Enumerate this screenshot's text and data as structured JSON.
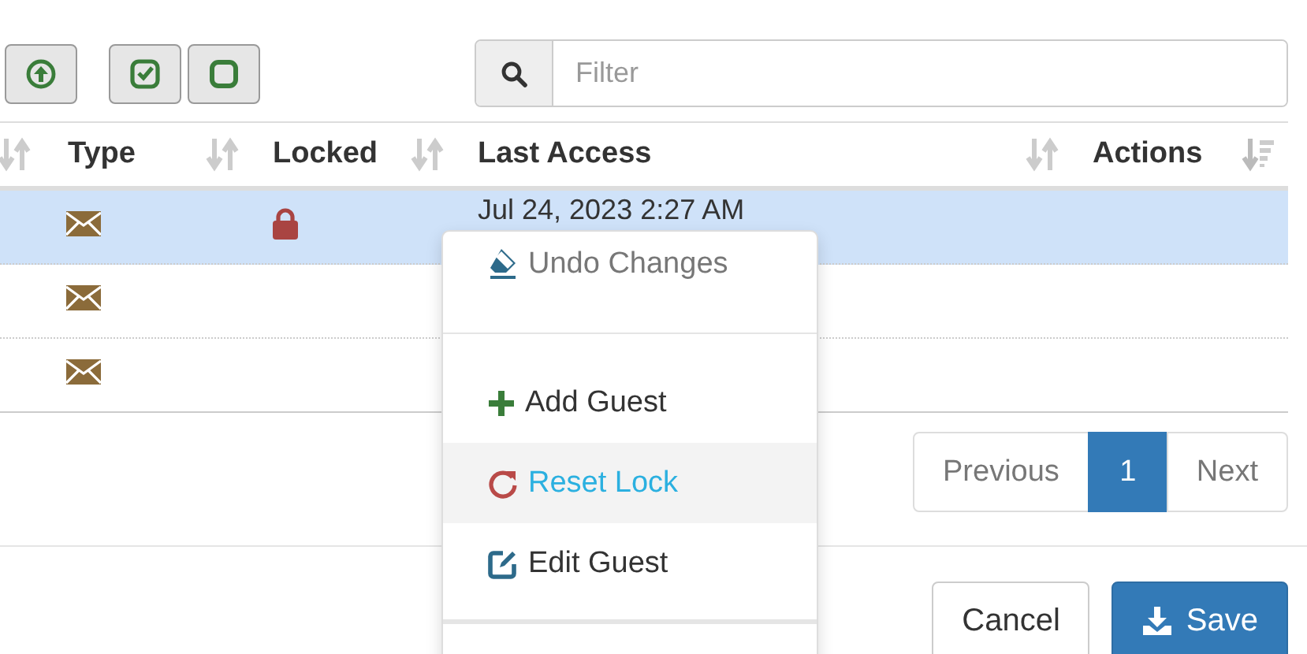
{
  "toolbar": {
    "buttons": [
      {
        "kind": "upload"
      },
      {
        "kind": "check-all"
      },
      {
        "kind": "uncheck-all"
      }
    ],
    "search": {
      "placeholder": "Filter"
    }
  },
  "table": {
    "columns": [
      {
        "sorted": false
      },
      {
        "label": "Type",
        "sorted": false
      },
      {
        "label": "Locked",
        "sorted": false
      },
      {
        "label": "Last Access",
        "sorted": false
      },
      {
        "label": "Actions",
        "sorted": true
      }
    ],
    "rows": [
      {
        "selected": true,
        "locked": true,
        "last_access": "Jul 24, 2023 2:27 AM"
      },
      {
        "selected": false,
        "locked": false
      },
      {
        "selected": false,
        "locked": false
      }
    ]
  },
  "pagination": [
    {
      "label": "Previous",
      "selected": false
    },
    {
      "label": "1",
      "selected": true
    },
    {
      "label": "Next",
      "selected": false
    }
  ],
  "context_menu": [
    {
      "kind": "undo",
      "label": "Undo Changes",
      "disabled": true,
      "highlighted": false
    },
    {
      "kind": "divider"
    },
    {
      "kind": "add",
      "label": "Add Guest",
      "disabled": false,
      "highlighted": false
    },
    {
      "kind": "reset",
      "label": "Reset Lock",
      "disabled": false,
      "highlighted": true
    },
    {
      "kind": "edit",
      "label": "Edit Guest",
      "disabled": false,
      "highlighted": false
    },
    {
      "kind": "divider"
    }
  ],
  "footer": {
    "cancel": "Cancel",
    "save": "Save"
  }
}
